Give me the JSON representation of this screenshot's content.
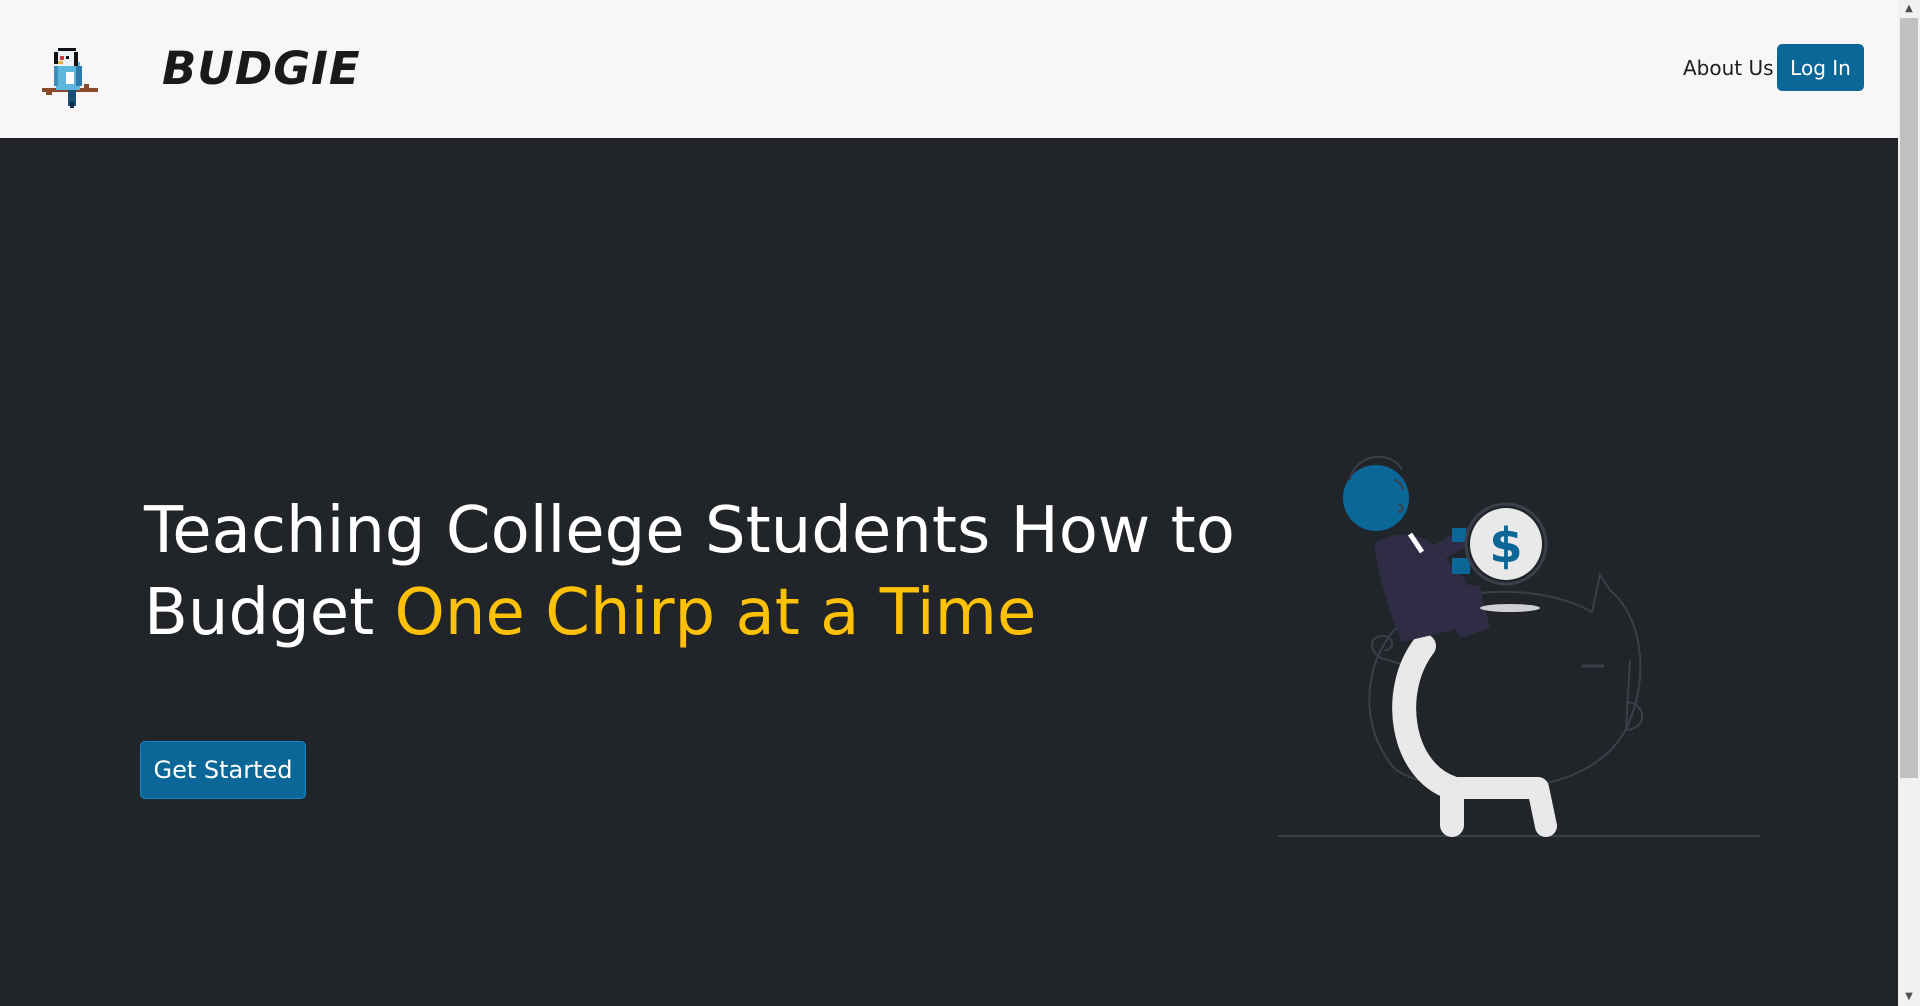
{
  "brand": {
    "name": "BUDGIE",
    "logo_icon": "budgie-bird-icon"
  },
  "nav": {
    "about_label": "About Us",
    "login_label": "Log In"
  },
  "hero": {
    "heading_line1": "Teaching College Students How to",
    "heading_line2_plain": "Budget",
    "heading_line2_accent": "One Chirp at a Time",
    "cta_label": "Get Started",
    "illustration_icon": "person-piggy-bank-illustration",
    "coin_symbol": "$"
  },
  "colors": {
    "primary": "#0b6797",
    "accent": "#ffc107",
    "hero_bg": "#212529",
    "navbar_bg": "#f8f6f6"
  }
}
